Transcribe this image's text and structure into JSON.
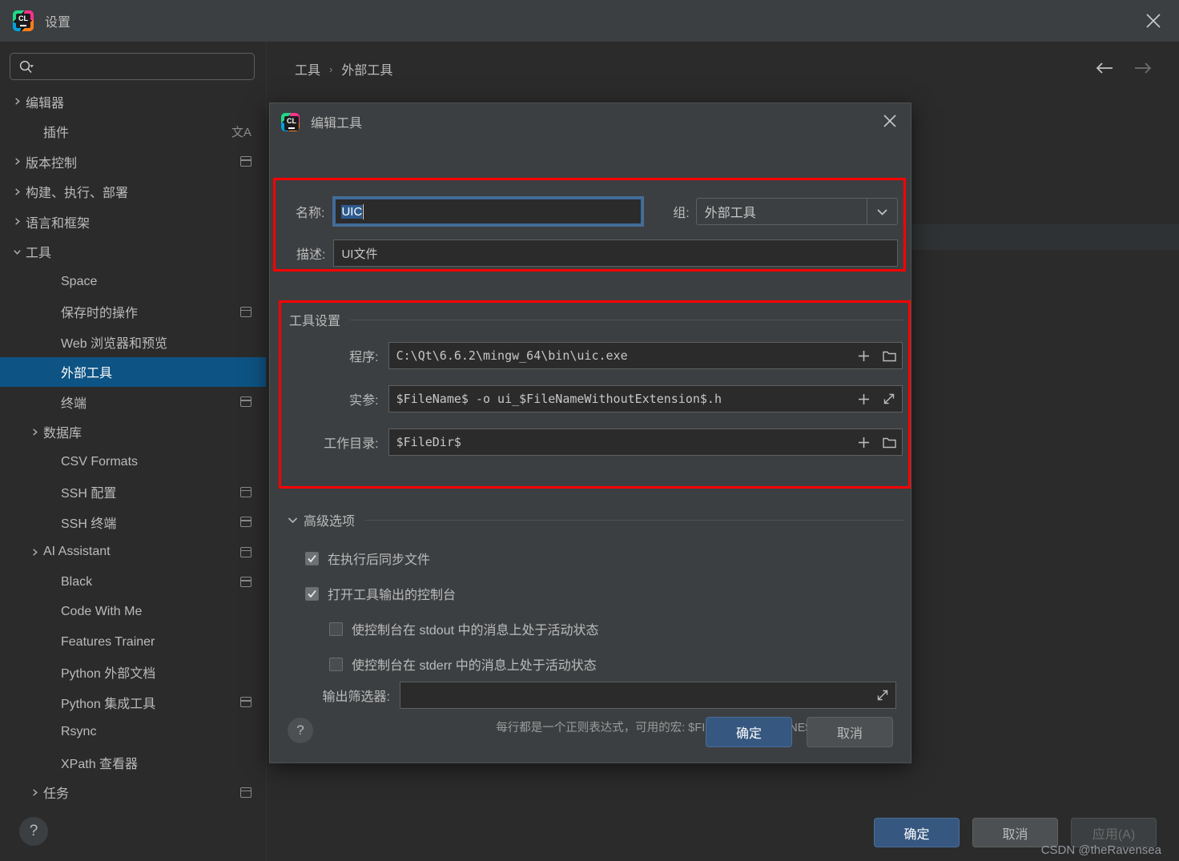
{
  "window": {
    "title": "设置",
    "logo_text": "CL",
    "close_icon": "close-icon"
  },
  "sidebar": {
    "search": {
      "placeholder": "",
      "value": "",
      "icon": "search-icon"
    },
    "items": [
      {
        "label": "编辑器",
        "expandable": true,
        "expanded": false,
        "indent": 0,
        "selected": false,
        "right_icon": ""
      },
      {
        "label": "插件",
        "expandable": false,
        "expanded": false,
        "indent": 1,
        "selected": false,
        "right_icon": "translate-icon"
      },
      {
        "label": "版本控制",
        "expandable": true,
        "expanded": false,
        "indent": 0,
        "selected": false,
        "right_icon": "copy-icon"
      },
      {
        "label": "构建、执行、部署",
        "expandable": true,
        "expanded": false,
        "indent": 0,
        "selected": false,
        "right_icon": ""
      },
      {
        "label": "语言和框架",
        "expandable": true,
        "expanded": false,
        "indent": 0,
        "selected": false,
        "right_icon": ""
      },
      {
        "label": "工具",
        "expandable": true,
        "expanded": true,
        "indent": 0,
        "selected": false,
        "right_icon": ""
      },
      {
        "label": "Space",
        "expandable": false,
        "expanded": false,
        "indent": 2,
        "selected": false,
        "right_icon": ""
      },
      {
        "label": "保存时的操作",
        "expandable": false,
        "expanded": false,
        "indent": 2,
        "selected": false,
        "right_icon": "copy-icon"
      },
      {
        "label": "Web 浏览器和预览",
        "expandable": false,
        "expanded": false,
        "indent": 2,
        "selected": false,
        "right_icon": ""
      },
      {
        "label": "外部工具",
        "expandable": false,
        "expanded": false,
        "indent": 2,
        "selected": true,
        "right_icon": ""
      },
      {
        "label": "终端",
        "expandable": false,
        "expanded": false,
        "indent": 2,
        "selected": false,
        "right_icon": "copy-icon"
      },
      {
        "label": "数据库",
        "expandable": true,
        "expanded": false,
        "indent": 1,
        "selected": false,
        "right_icon": ""
      },
      {
        "label": "CSV Formats",
        "expandable": false,
        "expanded": false,
        "indent": 2,
        "selected": false,
        "right_icon": ""
      },
      {
        "label": "SSH 配置",
        "expandable": false,
        "expanded": false,
        "indent": 2,
        "selected": false,
        "right_icon": "copy-icon"
      },
      {
        "label": "SSH 终端",
        "expandable": false,
        "expanded": false,
        "indent": 2,
        "selected": false,
        "right_icon": "copy-icon"
      },
      {
        "label": "AI Assistant",
        "expandable": true,
        "expanded": false,
        "indent": 1,
        "selected": false,
        "right_icon": "copy-icon"
      },
      {
        "label": "Black",
        "expandable": false,
        "expanded": false,
        "indent": 2,
        "selected": false,
        "right_icon": "copy-icon"
      },
      {
        "label": "Code With Me",
        "expandable": false,
        "expanded": false,
        "indent": 2,
        "selected": false,
        "right_icon": ""
      },
      {
        "label": "Features Trainer",
        "expandable": false,
        "expanded": false,
        "indent": 2,
        "selected": false,
        "right_icon": ""
      },
      {
        "label": "Python 外部文档",
        "expandable": false,
        "expanded": false,
        "indent": 2,
        "selected": false,
        "right_icon": ""
      },
      {
        "label": "Python 集成工具",
        "expandable": false,
        "expanded": false,
        "indent": 2,
        "selected": false,
        "right_icon": "copy-icon"
      },
      {
        "label": "Rsync",
        "expandable": false,
        "expanded": false,
        "indent": 2,
        "selected": false,
        "right_icon": ""
      },
      {
        "label": "XPath 查看器",
        "expandable": false,
        "expanded": false,
        "indent": 2,
        "selected": false,
        "right_icon": ""
      },
      {
        "label": "任务",
        "expandable": true,
        "expanded": false,
        "indent": 1,
        "selected": false,
        "right_icon": "copy-icon"
      }
    ],
    "help_label": "?"
  },
  "main": {
    "breadcrumb": {
      "parent": "工具",
      "separator": "›",
      "current": "外部工具"
    },
    "nav": {
      "back_icon": "arrow-left-icon",
      "forward_icon": "arrow-right-icon"
    },
    "buttons": {
      "ok": "确定",
      "cancel": "取消",
      "apply": "应用(A)"
    },
    "watermark": "CSDN @theRavensea"
  },
  "dialog": {
    "title": "编辑工具",
    "logo_text": "CL",
    "close_icon": "close-icon",
    "name": {
      "label": "名称:",
      "value": "UIC",
      "selected_text": "UIC"
    },
    "group": {
      "label": "组:",
      "value": "外部工具",
      "chevron": "chevron-down-icon"
    },
    "description": {
      "label": "描述:",
      "value": "UI文件"
    },
    "tool_settings": {
      "title": "工具设置",
      "program": {
        "label": "程序:",
        "value": "C:\\Qt\\6.6.2\\mingw_64\\bin\\uic.exe",
        "actions": [
          "plus-icon",
          "folder-icon"
        ]
      },
      "arguments": {
        "label": "实参:",
        "value": "$FileName$ -o ui_$FileNameWithoutExtension$.h",
        "actions": [
          "plus-icon",
          "expand-icon"
        ]
      },
      "working_directory": {
        "label": "工作目录:",
        "value": "$FileDir$",
        "actions": [
          "plus-icon",
          "folder-icon"
        ]
      }
    },
    "advanced": {
      "title": "高级选项",
      "chevron": "chevron-down-icon",
      "options": [
        {
          "label": "在执行后同步文件",
          "checked": true,
          "indent": 0
        },
        {
          "label": "打开工具输出的控制台",
          "checked": true,
          "indent": 0
        },
        {
          "label": "使控制台在 stdout 中的消息上处于活动状态",
          "checked": false,
          "indent": 1
        },
        {
          "label": "使控制台在 stderr 中的消息上处于活动状态",
          "checked": false,
          "indent": 1
        }
      ],
      "output_filter": {
        "label": "输出筛选器:",
        "value": "",
        "action_icon": "expand-icon",
        "hint": "每行都是一个正则表达式，可用的宏: $FILE_PATH$、$LINE$ 和 $COLUMN$"
      }
    },
    "footer": {
      "help_label": "?",
      "ok": "确定",
      "cancel": "取消"
    }
  },
  "colors": {
    "accent_selected": "#0d5383",
    "primary_button": "#365880",
    "highlight_box": "#ff0000",
    "dialog_bg": "#3c3f41",
    "window_bg": "#2b2b2b"
  }
}
